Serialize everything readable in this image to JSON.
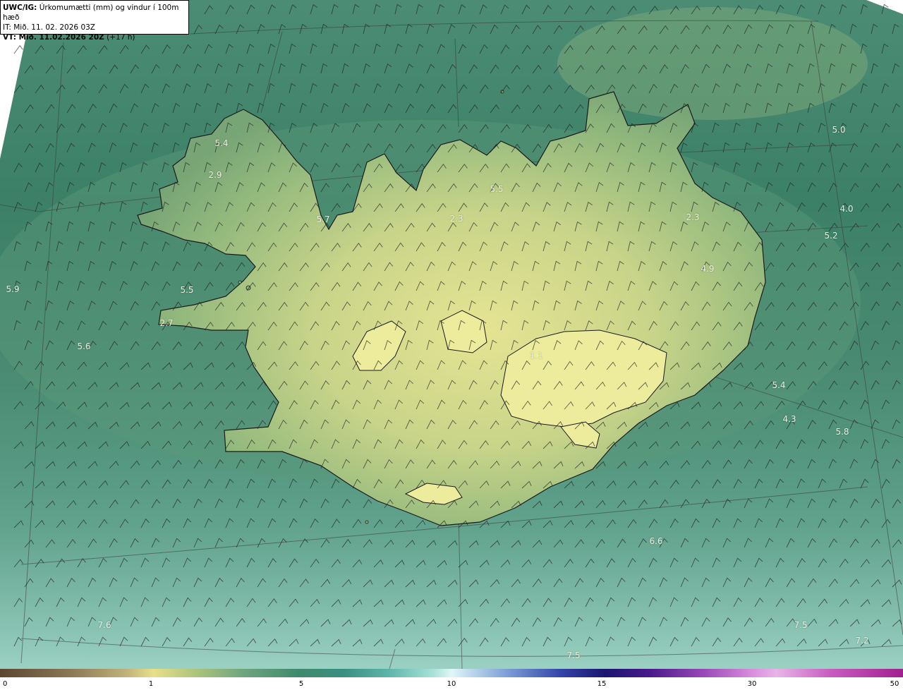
{
  "header": {
    "product_code": "UWC/IG:",
    "product_desc": "Úrkomumætti (mm) og vindur í 100m hæð",
    "init_line": "IT: Mið. 11. 02. 2026 03Z",
    "valid_prefix": "VT: Mið. 11.02.2026 20Z",
    "valid_suffix": "(+17 h)"
  },
  "colorbar": {
    "ticks": [
      "0",
      "1",
      "5",
      "10",
      "15",
      "30",
      "50"
    ]
  },
  "value_labels": [
    "5.4",
    "2.9",
    "5.7",
    "5.5",
    "2.3",
    "2.3",
    "4.9",
    "5.0",
    "4.0",
    "5.2",
    "5.9",
    "5.5",
    "2.7",
    "5.6",
    "1.1",
    "5.4",
    "4.3",
    "5.8",
    "6.6",
    "7.5",
    "7.2",
    "7.5",
    "7.6"
  ],
  "colors": {
    "ocean": "#3c8068",
    "land_low": "#7fa873",
    "land_high": "#e3e394",
    "outline": "#1a1a1a",
    "barb": "#222222"
  }
}
